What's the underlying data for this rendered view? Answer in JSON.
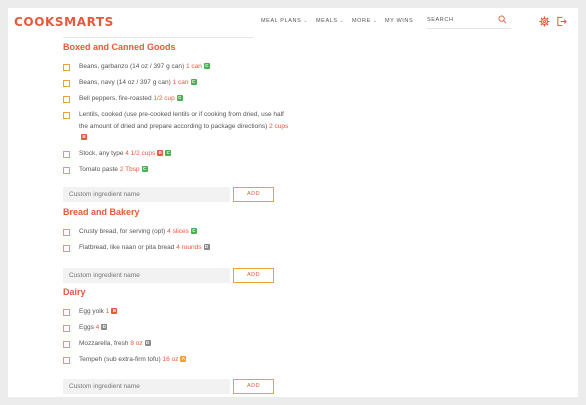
{
  "header": {
    "logo": "COOKSMARTS",
    "nav": [
      {
        "label": "MEAL PLANS",
        "has_dropdown": true
      },
      {
        "label": "MEALS",
        "has_dropdown": true
      },
      {
        "label": "MORE",
        "has_dropdown": true
      },
      {
        "label": "MY WINS",
        "has_dropdown": false
      }
    ],
    "search_placeholder": "SEARCH",
    "icons": [
      "search-icon",
      "gear-icon",
      "logout-icon"
    ]
  },
  "colors": {
    "accent": "#e8583a",
    "checkbox_border": "#e8a23a",
    "badge_green": "#4caf50",
    "badge_red": "#e8583a",
    "badge_gray": "#8a8a8a",
    "badge_orange": "#f0a030"
  },
  "sections": [
    {
      "title": "Boxed and Canned Goods",
      "items": [
        {
          "name": "Beans, garbanzo (14 oz / 397 g can)",
          "qty": "1 can",
          "badges": [
            {
              "letter": "C",
              "color": "green"
            }
          ]
        },
        {
          "name": "Beans, navy (14 oz / 397 g can)",
          "qty": "1 can",
          "badges": [
            {
              "letter": "C",
              "color": "green"
            }
          ]
        },
        {
          "name": "Bell peppers, fire-roasted",
          "qty": "1/2 cup",
          "badges": [
            {
              "letter": "C",
              "color": "green"
            }
          ]
        },
        {
          "name": "Lentils, cooked (use pre-cooked lentils or if cooking from dried, use half the amount of dried and prepare according to package directions)",
          "qty": "2 cups",
          "badges": [
            {
              "letter": "B",
              "color": "red"
            }
          ]
        },
        {
          "name": "Stock, any type",
          "qty": "4 1/2 cups",
          "badges": [
            {
              "letter": "B",
              "color": "red"
            },
            {
              "letter": "C",
              "color": "green"
            }
          ]
        },
        {
          "name": "Tomato paste",
          "qty": "2 Tbsp",
          "badges": [
            {
              "letter": "C",
              "color": "green"
            }
          ]
        }
      ],
      "custom_placeholder": "Custom ingredient name",
      "add_label": "ADD"
    },
    {
      "title": "Bread and Bakery",
      "items": [
        {
          "name": "Crusty bread, for serving (opt)",
          "qty": "4 slices",
          "badges": [
            {
              "letter": "C",
              "color": "green"
            }
          ]
        },
        {
          "name": "Flatbread, like naan or pita bread",
          "qty": "4 rounds",
          "badges": [
            {
              "letter": "D",
              "color": "gray"
            }
          ]
        }
      ],
      "custom_placeholder": "Custom ingredient name",
      "add_label": "ADD"
    },
    {
      "title": "Dairy",
      "items": [
        {
          "name": "Egg yolk",
          "qty": "1",
          "badges": [
            {
              "letter": "B",
              "color": "red"
            }
          ]
        },
        {
          "name": "Eggs",
          "qty": "4",
          "badges": [
            {
              "letter": "D",
              "color": "gray"
            }
          ]
        },
        {
          "name": "Mozzarella, fresh",
          "qty": "8 oz",
          "badges": [
            {
              "letter": "D",
              "color": "gray"
            }
          ]
        },
        {
          "name": "Tempeh (sub extra-firm tofu)",
          "qty": "16 oz",
          "badges": [
            {
              "letter": "A",
              "color": "orange"
            }
          ]
        }
      ],
      "custom_placeholder": "Custom ingredient name",
      "add_label": "ADD"
    }
  ]
}
